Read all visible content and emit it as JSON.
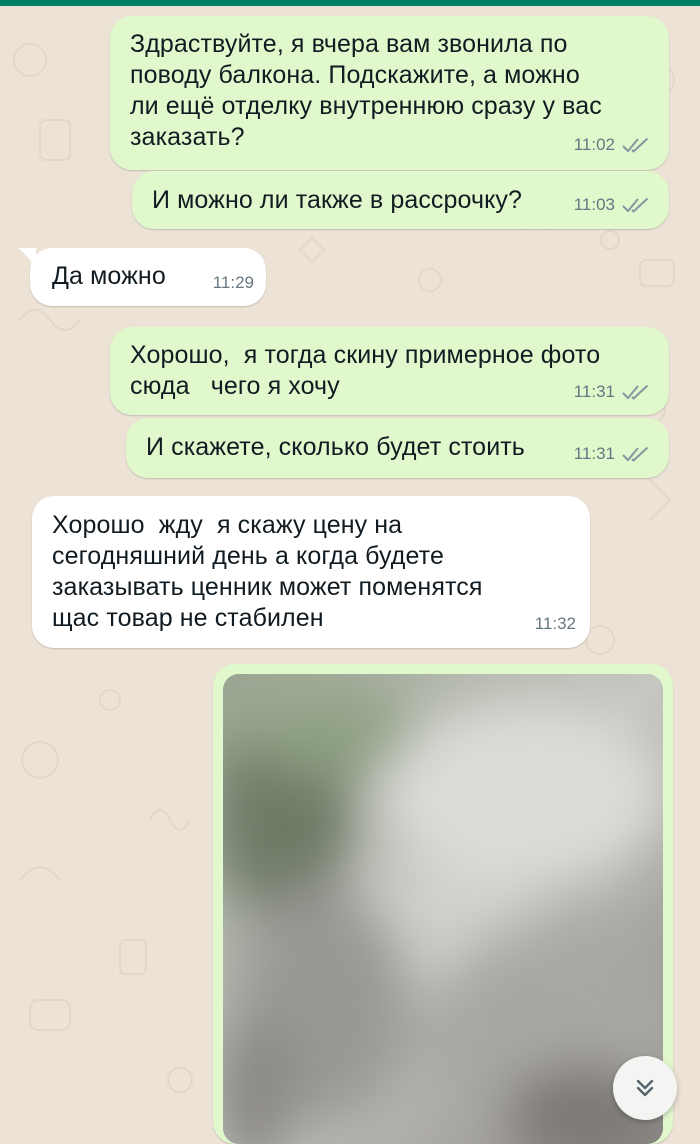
{
  "messages": [
    {
      "direction": "out",
      "text": "Здраствуйте, я вчера вам звонила по\nповоду балкона. Подскажите, а можно\nли ещё отделку внутреннюю сразу у вас\nзаказать?",
      "time": "11:02",
      "status": "read"
    },
    {
      "direction": "out",
      "text": "И можно ли также в рассрочку?",
      "time": "11:03",
      "status": "read"
    },
    {
      "direction": "in",
      "text": "Да можно",
      "time": "11:29"
    },
    {
      "direction": "out",
      "text": "Хорошо,  я тогда скину примерное фото\nсюда   чего я хочу",
      "time": "11:31",
      "status": "read"
    },
    {
      "direction": "out",
      "text": "И скажете, сколько будет стоить",
      "time": "11:31",
      "status": "read"
    },
    {
      "direction": "in",
      "text": "Хорошо  жду  я скажу цену на\nсегодняшний день а когда будете\nзаказывать ценник может поменятся\nщас товар не стабилен",
      "time": "11:32"
    }
  ],
  "photo_message": {
    "direction": "out",
    "content": "blurred photo"
  },
  "scroll_button": {
    "icon": "double-chevron-down-icon"
  },
  "colors": {
    "header": "#008069",
    "wallpaper": "#ece3d6",
    "outgoing_bubble": "#e1f8cd",
    "incoming_bubble": "#ffffff",
    "read_ticks": "#8696a0",
    "timestamp": "#667781"
  }
}
